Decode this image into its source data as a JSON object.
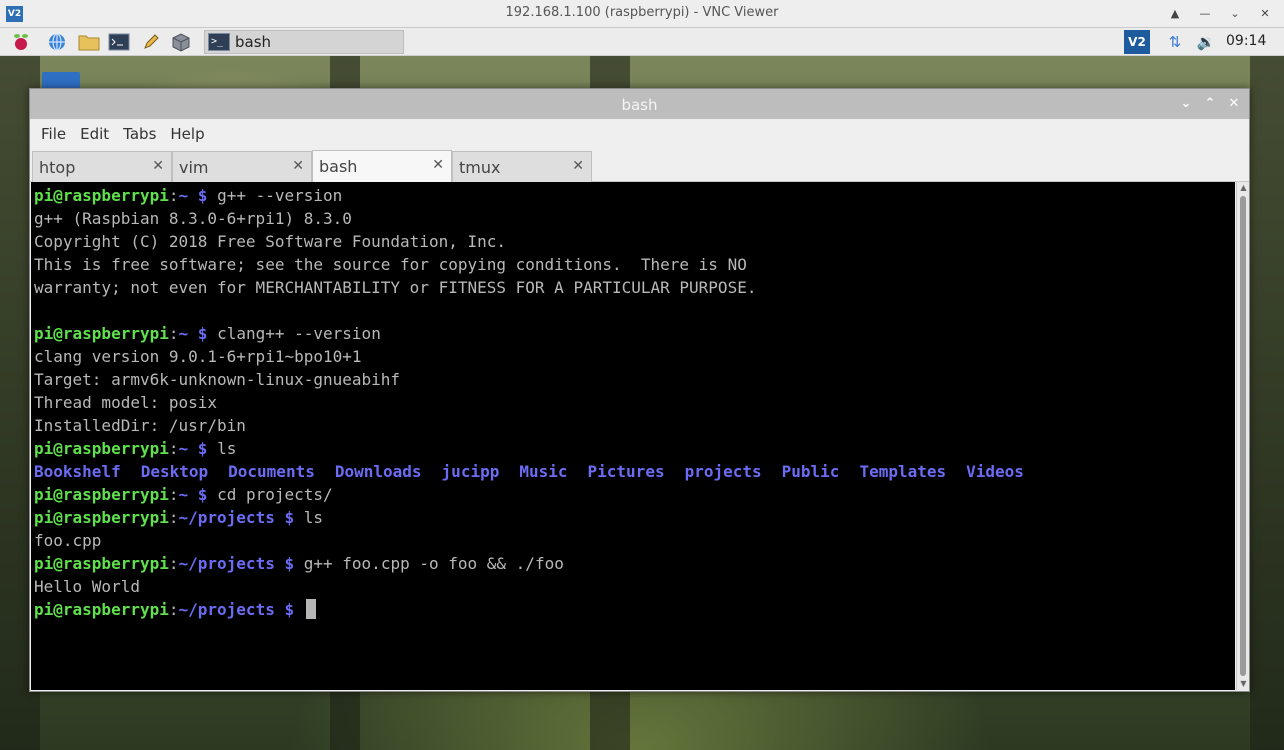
{
  "vnc": {
    "logo": "V2",
    "title": "192.168.1.100 (raspberrypi) - VNC Viewer",
    "controls": [
      "▲",
      "—",
      "⌄",
      "✕"
    ]
  },
  "panel": {
    "launchers": [
      "raspberry-icon",
      "web-browser-icon",
      "file-manager-icon",
      "terminal-icon",
      "text-editor-icon",
      "package-icon"
    ],
    "task_icon": ">_",
    "task_label": "bash",
    "tray_vnc": "V2",
    "clock": "09:14"
  },
  "window": {
    "title": "bash",
    "menu": [
      "File",
      "Edit",
      "Tabs",
      "Help"
    ],
    "tabs": [
      {
        "label": "htop",
        "active": false
      },
      {
        "label": "vim",
        "active": false
      },
      {
        "label": "bash",
        "active": true
      },
      {
        "label": "tmux",
        "active": false
      }
    ],
    "tab_close": "✕",
    "buttons": {
      "minimize": "⌄",
      "maximize": "⌃",
      "close": "✕"
    }
  },
  "terminal": {
    "lines": [
      {
        "user": "pi@raspberrypi",
        "path": "~",
        "cmd": "g++ --version"
      },
      {
        "text": "g++ (Raspbian 8.3.0-6+rpi1) 8.3.0"
      },
      {
        "text": "Copyright (C) 2018 Free Software Foundation, Inc."
      },
      {
        "text": "This is free software; see the source for copying conditions.  There is NO"
      },
      {
        "text": "warranty; not even for MERCHANTABILITY or FITNESS FOR A PARTICULAR PURPOSE."
      },
      {
        "text": ""
      },
      {
        "user": "pi@raspberrypi",
        "path": "~",
        "cmd": "clang++ --version"
      },
      {
        "text": "clang version 9.0.1-6+rpi1~bpo10+1"
      },
      {
        "text": "Target: armv6k-unknown-linux-gnueabihf"
      },
      {
        "text": "Thread model: posix"
      },
      {
        "text": "InstalledDir: /usr/bin"
      },
      {
        "user": "pi@raspberrypi",
        "path": "~",
        "cmd": "ls"
      },
      {
        "dirs": [
          "Bookshelf",
          "Desktop",
          "Documents",
          "Downloads",
          "jucipp",
          "Music",
          "Pictures",
          "projects",
          "Public",
          "Templates",
          "Videos"
        ]
      },
      {
        "user": "pi@raspberrypi",
        "path": "~",
        "cmd": "cd projects/"
      },
      {
        "user": "pi@raspberrypi",
        "path": "~/projects",
        "cmd": "ls"
      },
      {
        "text": "foo.cpp"
      },
      {
        "user": "pi@raspberrypi",
        "path": "~/projects",
        "cmd": "g++ foo.cpp -o foo && ./foo"
      },
      {
        "text": "Hello World"
      },
      {
        "user": "pi@raspberrypi",
        "path": "~/projects",
        "cmd": "",
        "cursor": true
      }
    ],
    "prompt_sep": ":",
    "prompt_symbol": "$"
  },
  "colors": {
    "prompt_user": "#5fe04c",
    "prompt_path": "#6b6cf3",
    "terminal_bg": "#000000",
    "terminal_fg": "#b8b8b8"
  }
}
